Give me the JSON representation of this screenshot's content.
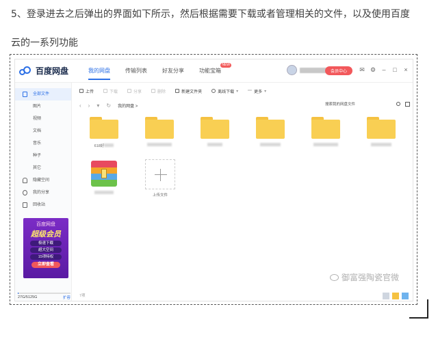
{
  "article": {
    "line1": "5、登录进去之后弹出的界面如下所示，然后根据需要下载或者管理相关的文件，以及使用百度",
    "line2": "云的一系列功能"
  },
  "app": {
    "logo": "百度网盘",
    "nav": [
      {
        "label": "我的网盘",
        "active": true
      },
      {
        "label": "传输列表"
      },
      {
        "label": "好友分享"
      },
      {
        "label": "功能宝箱",
        "badge": "NEW"
      }
    ],
    "vip_button": "会员中心",
    "window_controls": [
      "mail-icon",
      "gear-icon",
      "minimize-icon",
      "maximize-icon",
      "close-icon"
    ]
  },
  "sidebar": {
    "items": [
      {
        "label": "全部文件",
        "icon": "file-icon",
        "active": true
      },
      {
        "label": "图片"
      },
      {
        "label": "视频"
      },
      {
        "label": "文档"
      },
      {
        "label": "音乐"
      },
      {
        "label": "种子"
      },
      {
        "label": "其它"
      },
      {
        "label": "隐藏空间",
        "icon": "lock-icon"
      },
      {
        "label": "我的分享",
        "icon": "share-icon"
      },
      {
        "label": "回收站",
        "icon": "trash-icon"
      }
    ],
    "promo": {
      "title": "百度网盘",
      "headline": "超级会员",
      "perks": [
        "极速下载",
        "超大空间",
        "15项特权"
      ],
      "cta": "立即查看"
    },
    "storage": {
      "text": "27G/5125G",
      "used_fraction": 0.005,
      "expand": "扩容"
    }
  },
  "toolbar": {
    "buttons": [
      {
        "label": "上传",
        "icon": "upload-icon",
        "enabled": true
      },
      {
        "label": "下载",
        "icon": "download-icon",
        "enabled": false
      },
      {
        "label": "分享",
        "icon": "share-icon",
        "enabled": false
      },
      {
        "label": "删除",
        "icon": "trash-icon",
        "enabled": false
      },
      {
        "label": "新建文件夹",
        "icon": "new-folder-icon",
        "enabled": true
      },
      {
        "label": "离线下载",
        "icon": "offline-download-icon",
        "enabled": true
      },
      {
        "label": "更多",
        "icon": "more-icon",
        "enabled": true
      }
    ]
  },
  "pathbar": {
    "crumb": "我的网盘 >",
    "search_placeholder": "搜索我的网盘文件"
  },
  "files": [
    {
      "type": "folder",
      "name": "618好"
    },
    {
      "type": "folder",
      "name": ""
    },
    {
      "type": "folder",
      "name": ""
    },
    {
      "type": "folder",
      "name": ""
    },
    {
      "type": "folder",
      "name": ""
    },
    {
      "type": "folder",
      "name": ""
    },
    {
      "type": "archive",
      "name": ""
    },
    {
      "type": "upload",
      "name": "上传文件"
    }
  ],
  "status": {
    "count": "7项"
  },
  "watermark": "御富强陶瓷官微"
}
